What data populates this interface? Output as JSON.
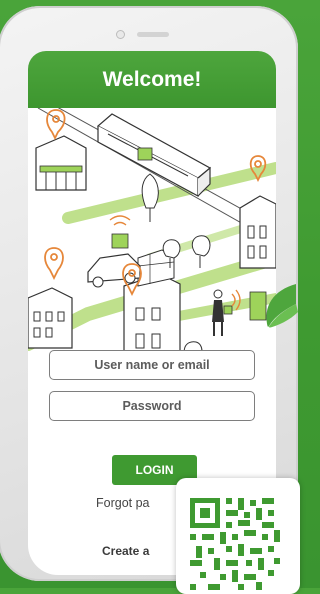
{
  "screen": {
    "title": "Welcome!"
  },
  "form": {
    "username_placeholder": "User name or email",
    "password_placeholder": "Password",
    "login_label": "LOGIN",
    "forgot_label": "Forgot pa",
    "create_label": "Create a"
  },
  "icons": [
    "map-pin-icon",
    "wifi-signal-icon",
    "leaf-icon",
    "qr-code-icon"
  ],
  "colors": {
    "brand_green": "#3f9a31",
    "header_green": "#4ea63d",
    "background_green": "#4aa43a",
    "pin_orange": "#e6873a",
    "lime_accent": "#9ed35a"
  }
}
